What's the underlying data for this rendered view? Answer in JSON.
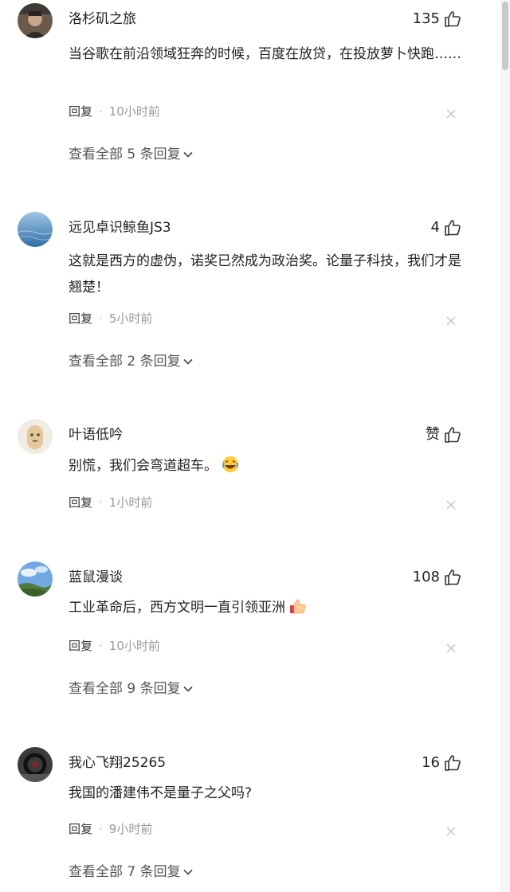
{
  "comments": [
    {
      "username": "洛杉矶之旅",
      "likes": "135",
      "text": "当谷歌在前沿领域狂奔的时候，百度在放贷，在投放萝卜快跑……",
      "reply_label": "回复",
      "separator": "·",
      "time": "10小时前",
      "view_all": "查看全部 5 条回复"
    },
    {
      "username": "远见卓识鲸鱼JS3",
      "likes": "4",
      "text": "这就是西方的虚伪，诺奖已然成为政治奖。论量子科技，我们才是翘楚！",
      "reply_label": "回复",
      "separator": "·",
      "time": "5小时前",
      "view_all": "查看全部 2 条回复"
    },
    {
      "username": "叶语低吟",
      "likes": "赞",
      "text": "别慌，我们会弯道超车。",
      "reply_label": "回复",
      "separator": "·",
      "time": "1小时前"
    },
    {
      "username": "蓝鼠漫谈",
      "likes": "108",
      "text": "工业革命后，西方文明一直引领亚洲",
      "reply_label": "回复",
      "separator": "·",
      "time": "10小时前",
      "view_all": "查看全部 9 条回复"
    },
    {
      "username": "我心飞翔25265",
      "likes": "16",
      "text": "我国的潘建伟不是量子之父吗?",
      "reply_label": "回复",
      "separator": "·",
      "time": "9小时前",
      "view_all": "查看全部 7 条回复"
    }
  ],
  "icons": {
    "like": "thumbs-up-icon",
    "close": "close-icon",
    "chevron": "chevron-down-icon",
    "emoji_laugh": "laughing-crying-emoji",
    "emoji_thumb": "thumbs-up-emoji"
  },
  "colors": {
    "text": "#222222",
    "meta": "#999999",
    "view_all": "#555555"
  }
}
